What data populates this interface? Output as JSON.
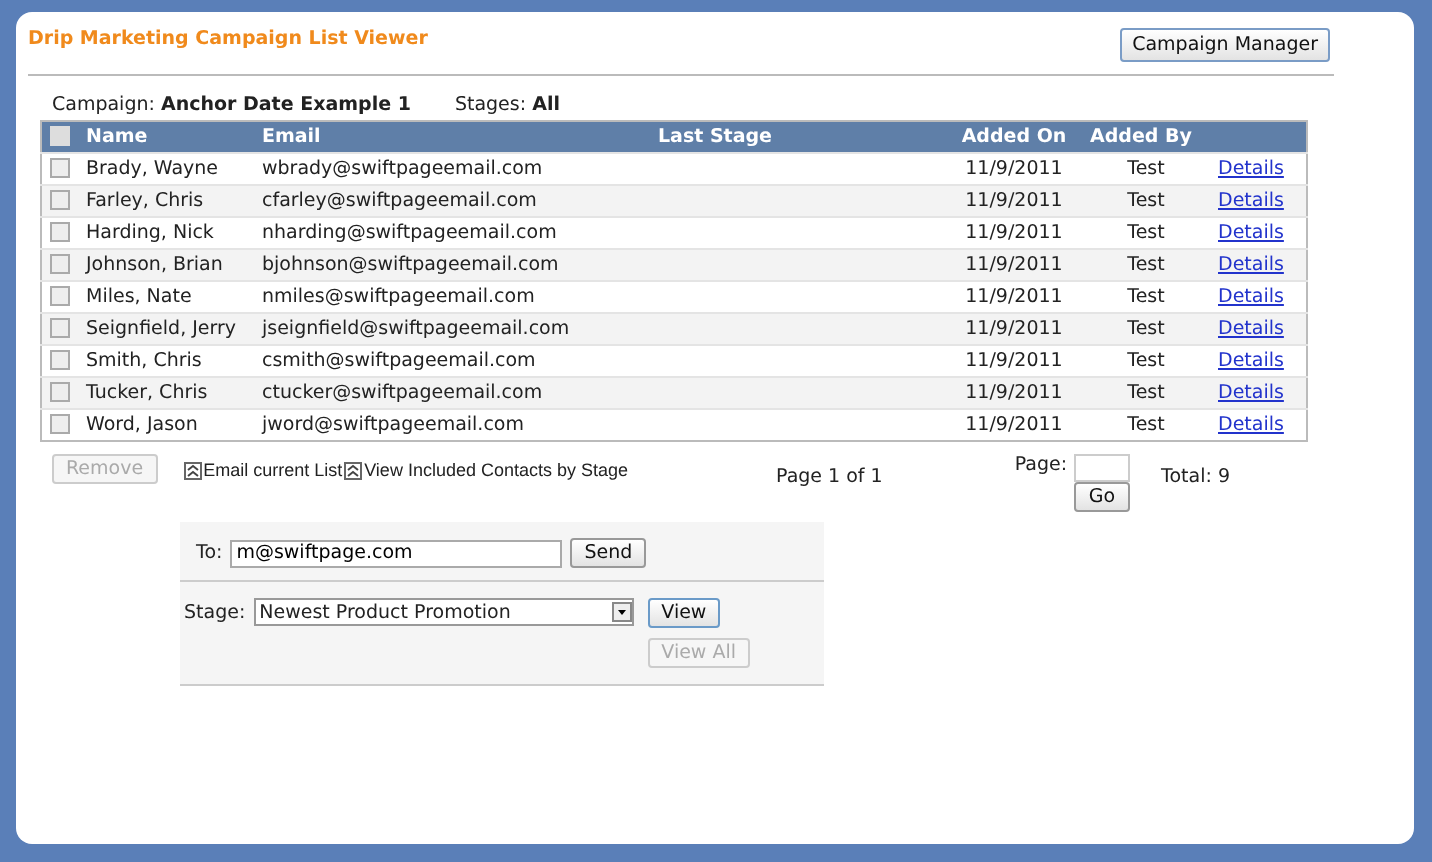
{
  "header": {
    "title": "Drip Marketing Campaign List Viewer",
    "manager_button": "Campaign Manager"
  },
  "summary": {
    "campaign_label": "Campaign:",
    "campaign": "Anchor Date Example 1",
    "stages_label": "Stages:",
    "stages": "All"
  },
  "table": {
    "select_all_checked": false,
    "columns": [
      "Name",
      "Email",
      "Last Stage",
      "Added On",
      "Added By"
    ],
    "rows": [
      {
        "checked": false,
        "name": "Brady, Wayne",
        "email": "wbrady@swiftpageemail.com",
        "added_on": "11/9/2011",
        "added_by": "Test",
        "link": "Details"
      },
      {
        "checked": false,
        "name": "Farley, Chris",
        "email": "cfarley@swiftpageemail.com",
        "added_on": "11/9/2011",
        "added_by": "Test",
        "link": "Details"
      },
      {
        "checked": false,
        "name": "Harding, Nick",
        "email": "nharding@swiftpageemail.com",
        "added_on": "11/9/2011",
        "added_by": "Test",
        "link": "Details"
      },
      {
        "checked": false,
        "name": "Johnson, Brian",
        "email": "bjohnson@swiftpageemail.com",
        "added_on": "11/9/2011",
        "added_by": "Test",
        "link": "Details"
      },
      {
        "checked": false,
        "name": "Miles, Nate",
        "email": "nmiles@swiftpageemail.com",
        "added_on": "11/9/2011",
        "added_by": "Test",
        "link": "Details"
      },
      {
        "checked": false,
        "name": "Seignfield, Jerry",
        "email": "jseignfield@swiftpageemail.com",
        "added_on": "11/9/2011",
        "added_by": "Test",
        "link": "Details"
      },
      {
        "checked": false,
        "name": "Smith, Chris",
        "email": "csmith@swiftpageemail.com",
        "added_on": "11/9/2011",
        "added_by": "Test",
        "link": "Details"
      },
      {
        "checked": false,
        "name": "Tucker, Chris",
        "email": "ctucker@swiftpageemail.com",
        "added_on": "11/9/2011",
        "added_by": "Test",
        "link": "Details"
      },
      {
        "checked": false,
        "name": "Word, Jason",
        "email": "jword@swiftpageemail.com",
        "added_on": "11/9/2011",
        "added_by": "Test",
        "link": "Details"
      }
    ]
  },
  "footer": {
    "remove_button": {
      "label": "Remove",
      "disabled": true
    },
    "links": [
      "Email current List",
      "View Included Contacts by Stage"
    ],
    "page_info": "Page 1 of 1",
    "page_label": "Page:",
    "go_button": "Go",
    "total": "Total: 9"
  },
  "email_panel": {
    "to_label": "To:",
    "to_value": "m@swiftpage.com",
    "send_button": "Send",
    "stage_label": "Stage:",
    "stage_value": "Newest Product Promotion",
    "view_button": {
      "label": "View",
      "disabled": false
    },
    "view_all_button": {
      "label": "View All",
      "disabled": true
    }
  }
}
